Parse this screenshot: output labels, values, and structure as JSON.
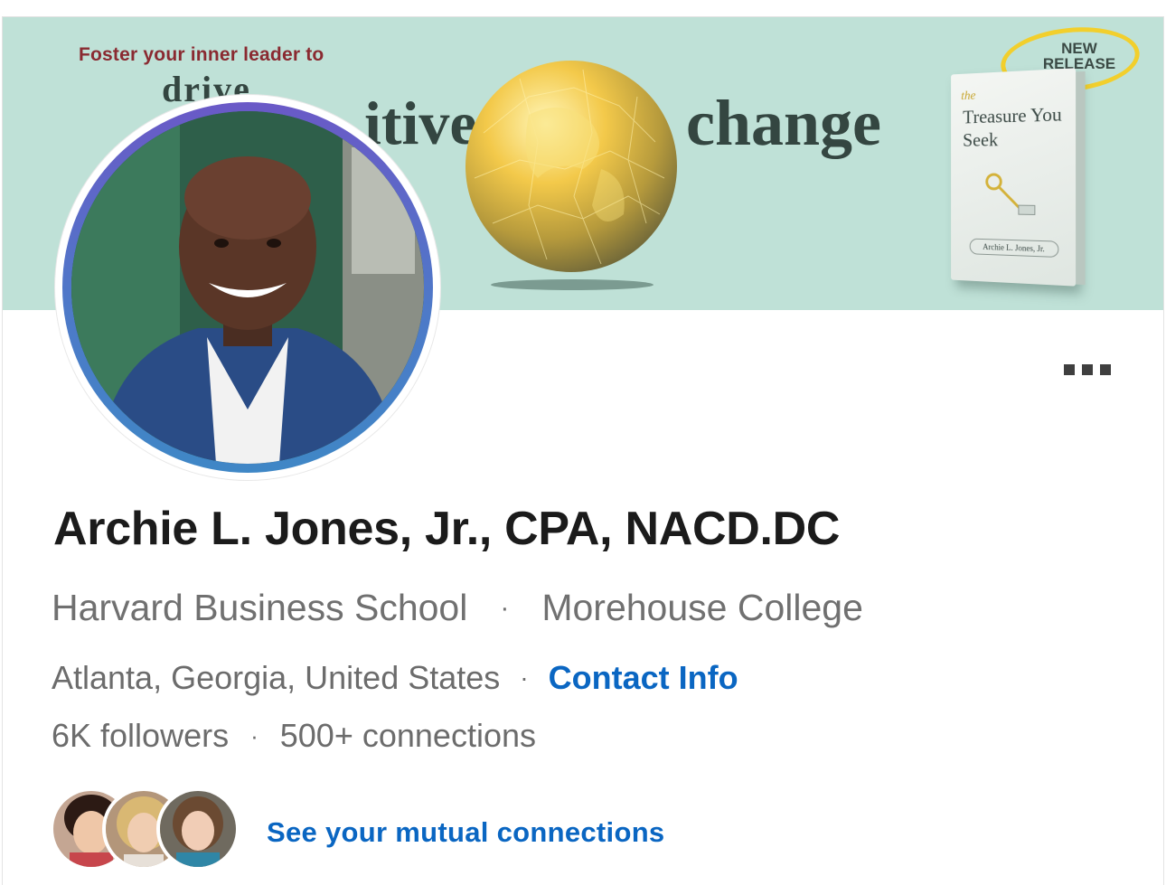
{
  "banner": {
    "tagline": "Foster your inner leader to",
    "headline_partial_drive": "drive",
    "headline_partial_positive": "itive",
    "headline_change": "change",
    "badge_line1": "NEW",
    "badge_line2": "RELEASE",
    "book_title_prefix": "the",
    "book_title": "Treasure You Seek",
    "book_author": "Archie L. Jones, Jr."
  },
  "profile": {
    "name": "Archie L. Jones, Jr., CPA, NACD.DC",
    "schools": [
      "Harvard Business School",
      "Morehouse College"
    ],
    "separator": "·",
    "location": "Atlanta, Georgia, United States",
    "contact_label": "Contact Info",
    "followers": "6K followers",
    "connections": "500+ connections"
  },
  "mutual": {
    "link_label": "See your mutual connections",
    "avatars": [
      "mutual-avatar-1",
      "mutual-avatar-2",
      "mutual-avatar-3"
    ]
  },
  "icons": {
    "more": "more-options-icon"
  },
  "colors": {
    "link": "#0a66c2",
    "banner_bg": "#bfe1d7",
    "ring_gradient_top": "#6a59c7",
    "ring_gradient_bottom": "#3f87c6"
  }
}
